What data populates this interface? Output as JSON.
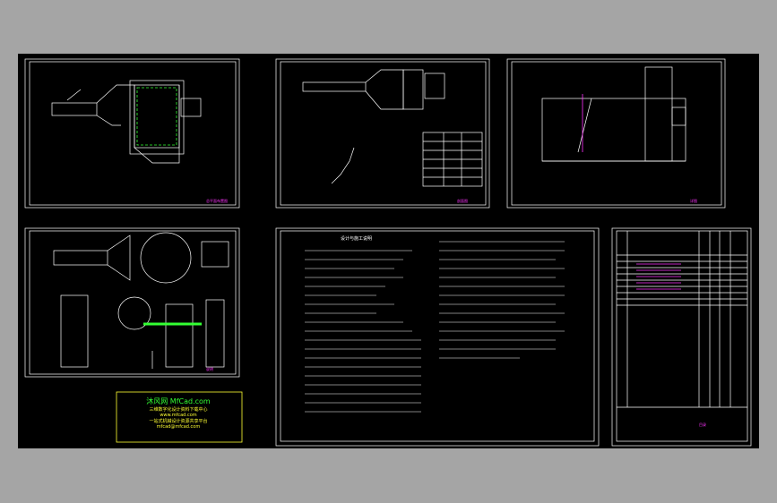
{
  "window": {
    "background_color": "#a5a5a5",
    "canvas_color": "#000000"
  },
  "drawing": {
    "line_color": "#ffffff",
    "accent_colors": {
      "magenta": "#ff33ff",
      "green": "#33ff33",
      "yellow": "#ffff33",
      "red": "#ff3333",
      "cyan": "#33ffff"
    },
    "notes_sheet": {
      "title": "设计与施工说明"
    },
    "stamp": {
      "brand": "沐风网 MfCad.com",
      "line1": "三维数字化设计资料下载中心",
      "line2": "www.mfcad.com",
      "line3": "一站式机械设计资源共享平台",
      "line4": "mfcad@mfcad.com"
    },
    "sheet_labels": [
      "总平面布置图",
      "剖面图",
      "详图",
      "说明",
      "目录"
    ]
  }
}
